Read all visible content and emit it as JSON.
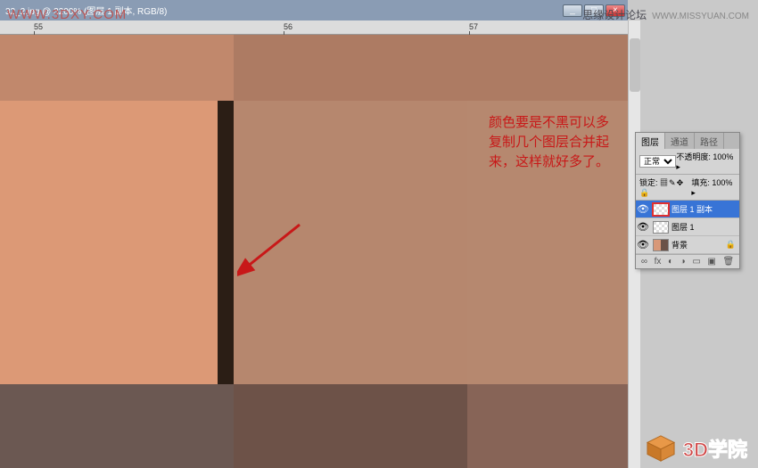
{
  "watermarks": {
    "top_left": "WWW.3DXY.COM",
    "top_right_label": "思缘设计论坛",
    "top_right_url": "WWW.MISSYUAN.COM"
  },
  "doc": {
    "title": "32_2.jpg @ 3200% (图层 1 副本, RGB/8)"
  },
  "ruler": {
    "ticks": [
      {
        "label": "55",
        "pos": 38
      },
      {
        "label": "56",
        "pos": 318
      },
      {
        "label": "57",
        "pos": 526
      }
    ]
  },
  "annotation": {
    "text": "颜色要是不黑可以多复制几个图层合并起来，这样就好多了。"
  },
  "panel": {
    "tabs": [
      "图层",
      "通道",
      "路径"
    ],
    "blend_mode": "正常",
    "opacity_label": "不透明度:",
    "opacity_value": "100%",
    "lock_label": "锁定:",
    "fill_label": "填充:",
    "fill_value": "100%",
    "layers": [
      {
        "name": "图层 1 副本",
        "selected": true,
        "locked": false,
        "bg": false
      },
      {
        "name": "图层 1",
        "selected": false,
        "locked": false,
        "bg": false
      },
      {
        "name": "背景",
        "selected": false,
        "locked": true,
        "bg": true
      }
    ]
  },
  "logo": {
    "text": "3D学院"
  },
  "win_controls": {
    "min": "_",
    "max": "□",
    "close": "×"
  }
}
